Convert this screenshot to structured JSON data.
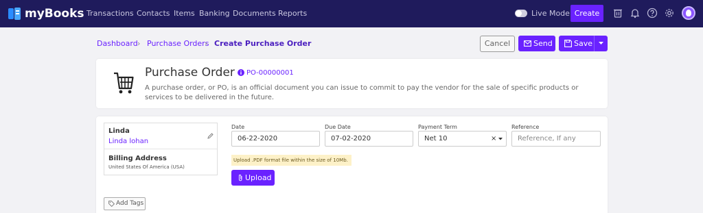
{
  "brand": {
    "name": "myBooks"
  },
  "nav": {
    "items": [
      {
        "label": "Transactions"
      },
      {
        "label": "Contacts"
      },
      {
        "label": "Items"
      },
      {
        "label": "Banking"
      },
      {
        "label": "Documents"
      },
      {
        "label": "Reports"
      }
    ],
    "live_mode_label": "Live Mode",
    "create_label": "Create",
    "icons": [
      "trash-icon",
      "bell-icon",
      "help-icon",
      "gear-icon",
      "avatar"
    ]
  },
  "breadcrumb": {
    "items": [
      {
        "label": "Dashboard"
      },
      {
        "label": "Purchase Orders"
      },
      {
        "label": "Create Purchase Order"
      }
    ]
  },
  "actions": {
    "cancel_label": "Cancel",
    "send_label": "Send",
    "save_label": "Save"
  },
  "header": {
    "title": "Purchase Order",
    "po_number": "PO-00000001",
    "description": "A purchase order, or PO, is an official document you can issue to commit to pay the vendor for the sale of specific products or services to be delivered in the future."
  },
  "vendor": {
    "name": "Linda",
    "contact": "Linda lohan",
    "billing_label": "Billing Address",
    "country": "United States Of America (USA)"
  },
  "form": {
    "date_label": "Date",
    "date_value": "06-22-2020",
    "due_date_label": "Due Date",
    "due_date_value": "07-02-2020",
    "payment_term_label": "Payment Term",
    "payment_term_value": "Net 10",
    "reference_label": "Reference",
    "reference_placeholder": "Reference, If any"
  },
  "upload": {
    "note": "Upload .PDF format file within the size of 10Mb.",
    "button_label": "Upload"
  },
  "tags": {
    "button_label": "Add Tags"
  },
  "colors": {
    "nav_bg": "#1f1b5c",
    "accent": "#6a22ff",
    "page_bg": "#f2f2f5"
  }
}
